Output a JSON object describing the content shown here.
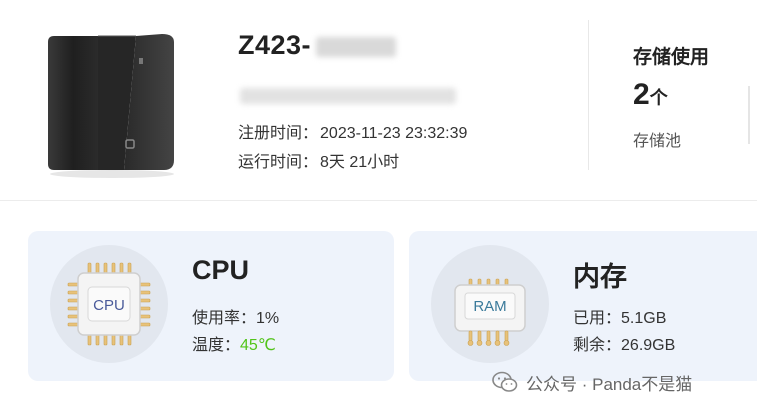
{
  "device": {
    "name": "Z423-",
    "registered_label": "注册时间：",
    "registered_value": "2023-11-23 23:32:39",
    "uptime_label": "运行时间：",
    "uptime_value": "8天 21小时"
  },
  "storage": {
    "title": "存储使用",
    "count": "2",
    "unit": "个",
    "label": "存储池"
  },
  "cpu": {
    "chip_label": "CPU",
    "title": "CPU",
    "usage_label": "使用率：",
    "usage_value": "1%",
    "temp_label": "温度：",
    "temp_value": "45℃"
  },
  "memory": {
    "chip_label": "RAM",
    "title": "内存",
    "used_label": "已用：",
    "used_value": "5.1GB",
    "free_label": "剩余：",
    "free_value": "26.9GB"
  },
  "watermark": {
    "text": "公众号 · Panda不是猫"
  },
  "colors": {
    "card_bg": "#eef3fb",
    "temp_ok": "#52c41a"
  }
}
